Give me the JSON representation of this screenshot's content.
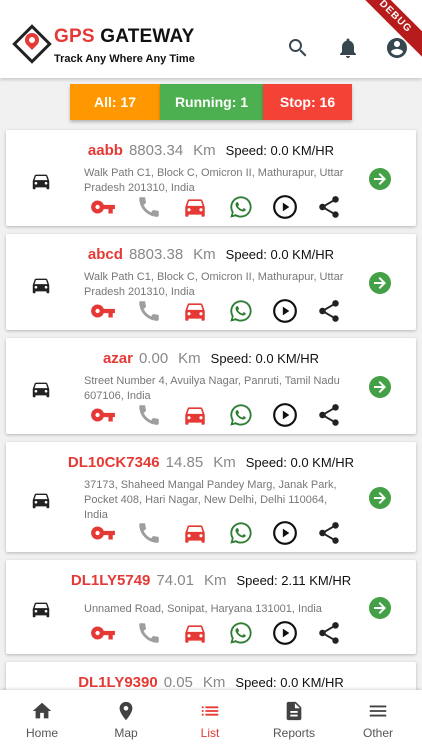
{
  "header": {
    "brand_gps": "GPS",
    "brand_gateway": "GATEWAY",
    "tagline": "Track Any Where Any Time",
    "debug_label": "DEBUG",
    "search_icon": "search-icon",
    "bell_icon": "bell-icon",
    "account_icon": "account-icon"
  },
  "filters": {
    "all": "All: 17",
    "running": "Running: 1",
    "stop": "Stop: 16"
  },
  "colors": {
    "accent_red": "#e53935",
    "all_orange": "#ff9800",
    "running_green": "#4caf50",
    "stop_red": "#f44336",
    "arrow_green": "#43a047"
  },
  "vehicles": [
    {
      "name": "aabb",
      "distance": "8803.34",
      "unit": "Km",
      "speed": "Speed: 0.0 KM/HR",
      "address": "Walk Path C1, Block C, Omicron II, Mathurapur, Uttar Pradesh 201310, India"
    },
    {
      "name": "abcd",
      "distance": "8803.38",
      "unit": "Km",
      "speed": "Speed: 0.0 KM/HR",
      "address": "Walk Path C1, Block C, Omicron II, Mathurapur, Uttar Pradesh 201310, India"
    },
    {
      "name": "azar",
      "distance": "0.00",
      "unit": "Km",
      "speed": "Speed: 0.0 KM/HR",
      "address": "Street Number 4, Avuilya Nagar, Panruti, Tamil Nadu 607106, India"
    },
    {
      "name": "DL10CK7346",
      "distance": "14.85",
      "unit": "Km",
      "speed": "Speed: 0.0 KM/HR",
      "address": "37173, Shaheed Mangal Pandey Marg, Janak Park, Pocket 408, Hari Nagar, New Delhi, Delhi 110064, India"
    },
    {
      "name": "DL1LY5749",
      "distance": "74.01",
      "unit": "Km",
      "speed": "Speed: 2.11 KM/HR",
      "address": "Unnamed Road, Sonipat, Haryana 131001, India"
    },
    {
      "name": "DL1LY9390",
      "distance": "0.05",
      "unit": "Km",
      "speed": "Speed: 0.0 KM/HR",
      "address": ""
    }
  ],
  "nav": {
    "home": "Home",
    "map": "Map",
    "list": "List",
    "reports": "Reports",
    "other": "Other"
  }
}
